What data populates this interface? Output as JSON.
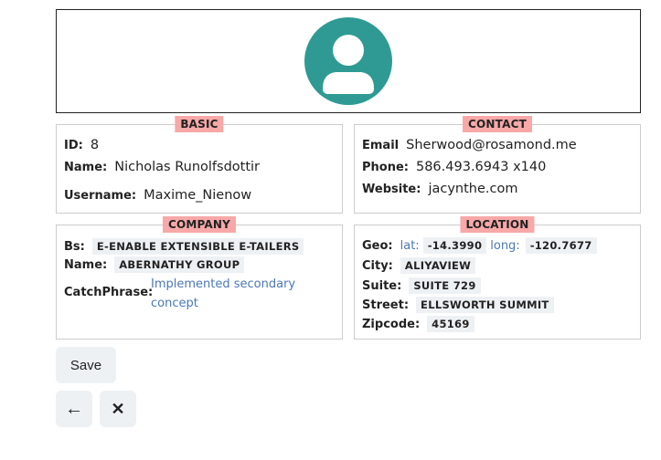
{
  "basic": {
    "tag": "BASIC",
    "id_label": "ID:",
    "id_value": "8",
    "name_label": "Name:",
    "name_value": "Nicholas Runolfsdottir",
    "username_label": "Username:",
    "username_value": "Maxime_Nienow"
  },
  "contact": {
    "tag": "CONTACT",
    "email_label": "Email",
    "email_value": "Sherwood@rosamond.me",
    "phone_label": "Phone:",
    "phone_value": "586.493.6943 x140",
    "website_label": "Website:",
    "website_value": "jacynthe.com"
  },
  "company": {
    "tag": "COMPANY",
    "bs_label": "Bs:",
    "bs_value": "E-ENABLE EXTENSIBLE E-TAILERS",
    "name_label": "Name:",
    "name_value": "ABERNATHY GROUP",
    "catchphrase_label": "CatchPhrase:",
    "catchphrase_line1": "Implemented secondary",
    "catchphrase_line2": "concept"
  },
  "location": {
    "tag": "LOCATION",
    "geo_label": "Geo:",
    "lat_label": "lat:",
    "lat_value": "-14.3990",
    "long_label": "long:",
    "long_value": "-120.7677",
    "city_label": "City:",
    "city_value": "ALIYAVIEW",
    "suite_label": "Suite:",
    "suite_value": "SUITE 729",
    "street_label": "Street:",
    "street_value": "ELLSWORTH SUMMIT",
    "zipcode_label": "Zipcode:",
    "zipcode_value": "45169"
  },
  "actions": {
    "save_label": "Save",
    "back_icon": "←",
    "close_icon": "✕"
  },
  "colors": {
    "avatar_bg": "#2e9a93",
    "tag_bg": "#f8a8a8",
    "chip_bg": "#eef1f4",
    "link_blue": "#4a78b5"
  }
}
